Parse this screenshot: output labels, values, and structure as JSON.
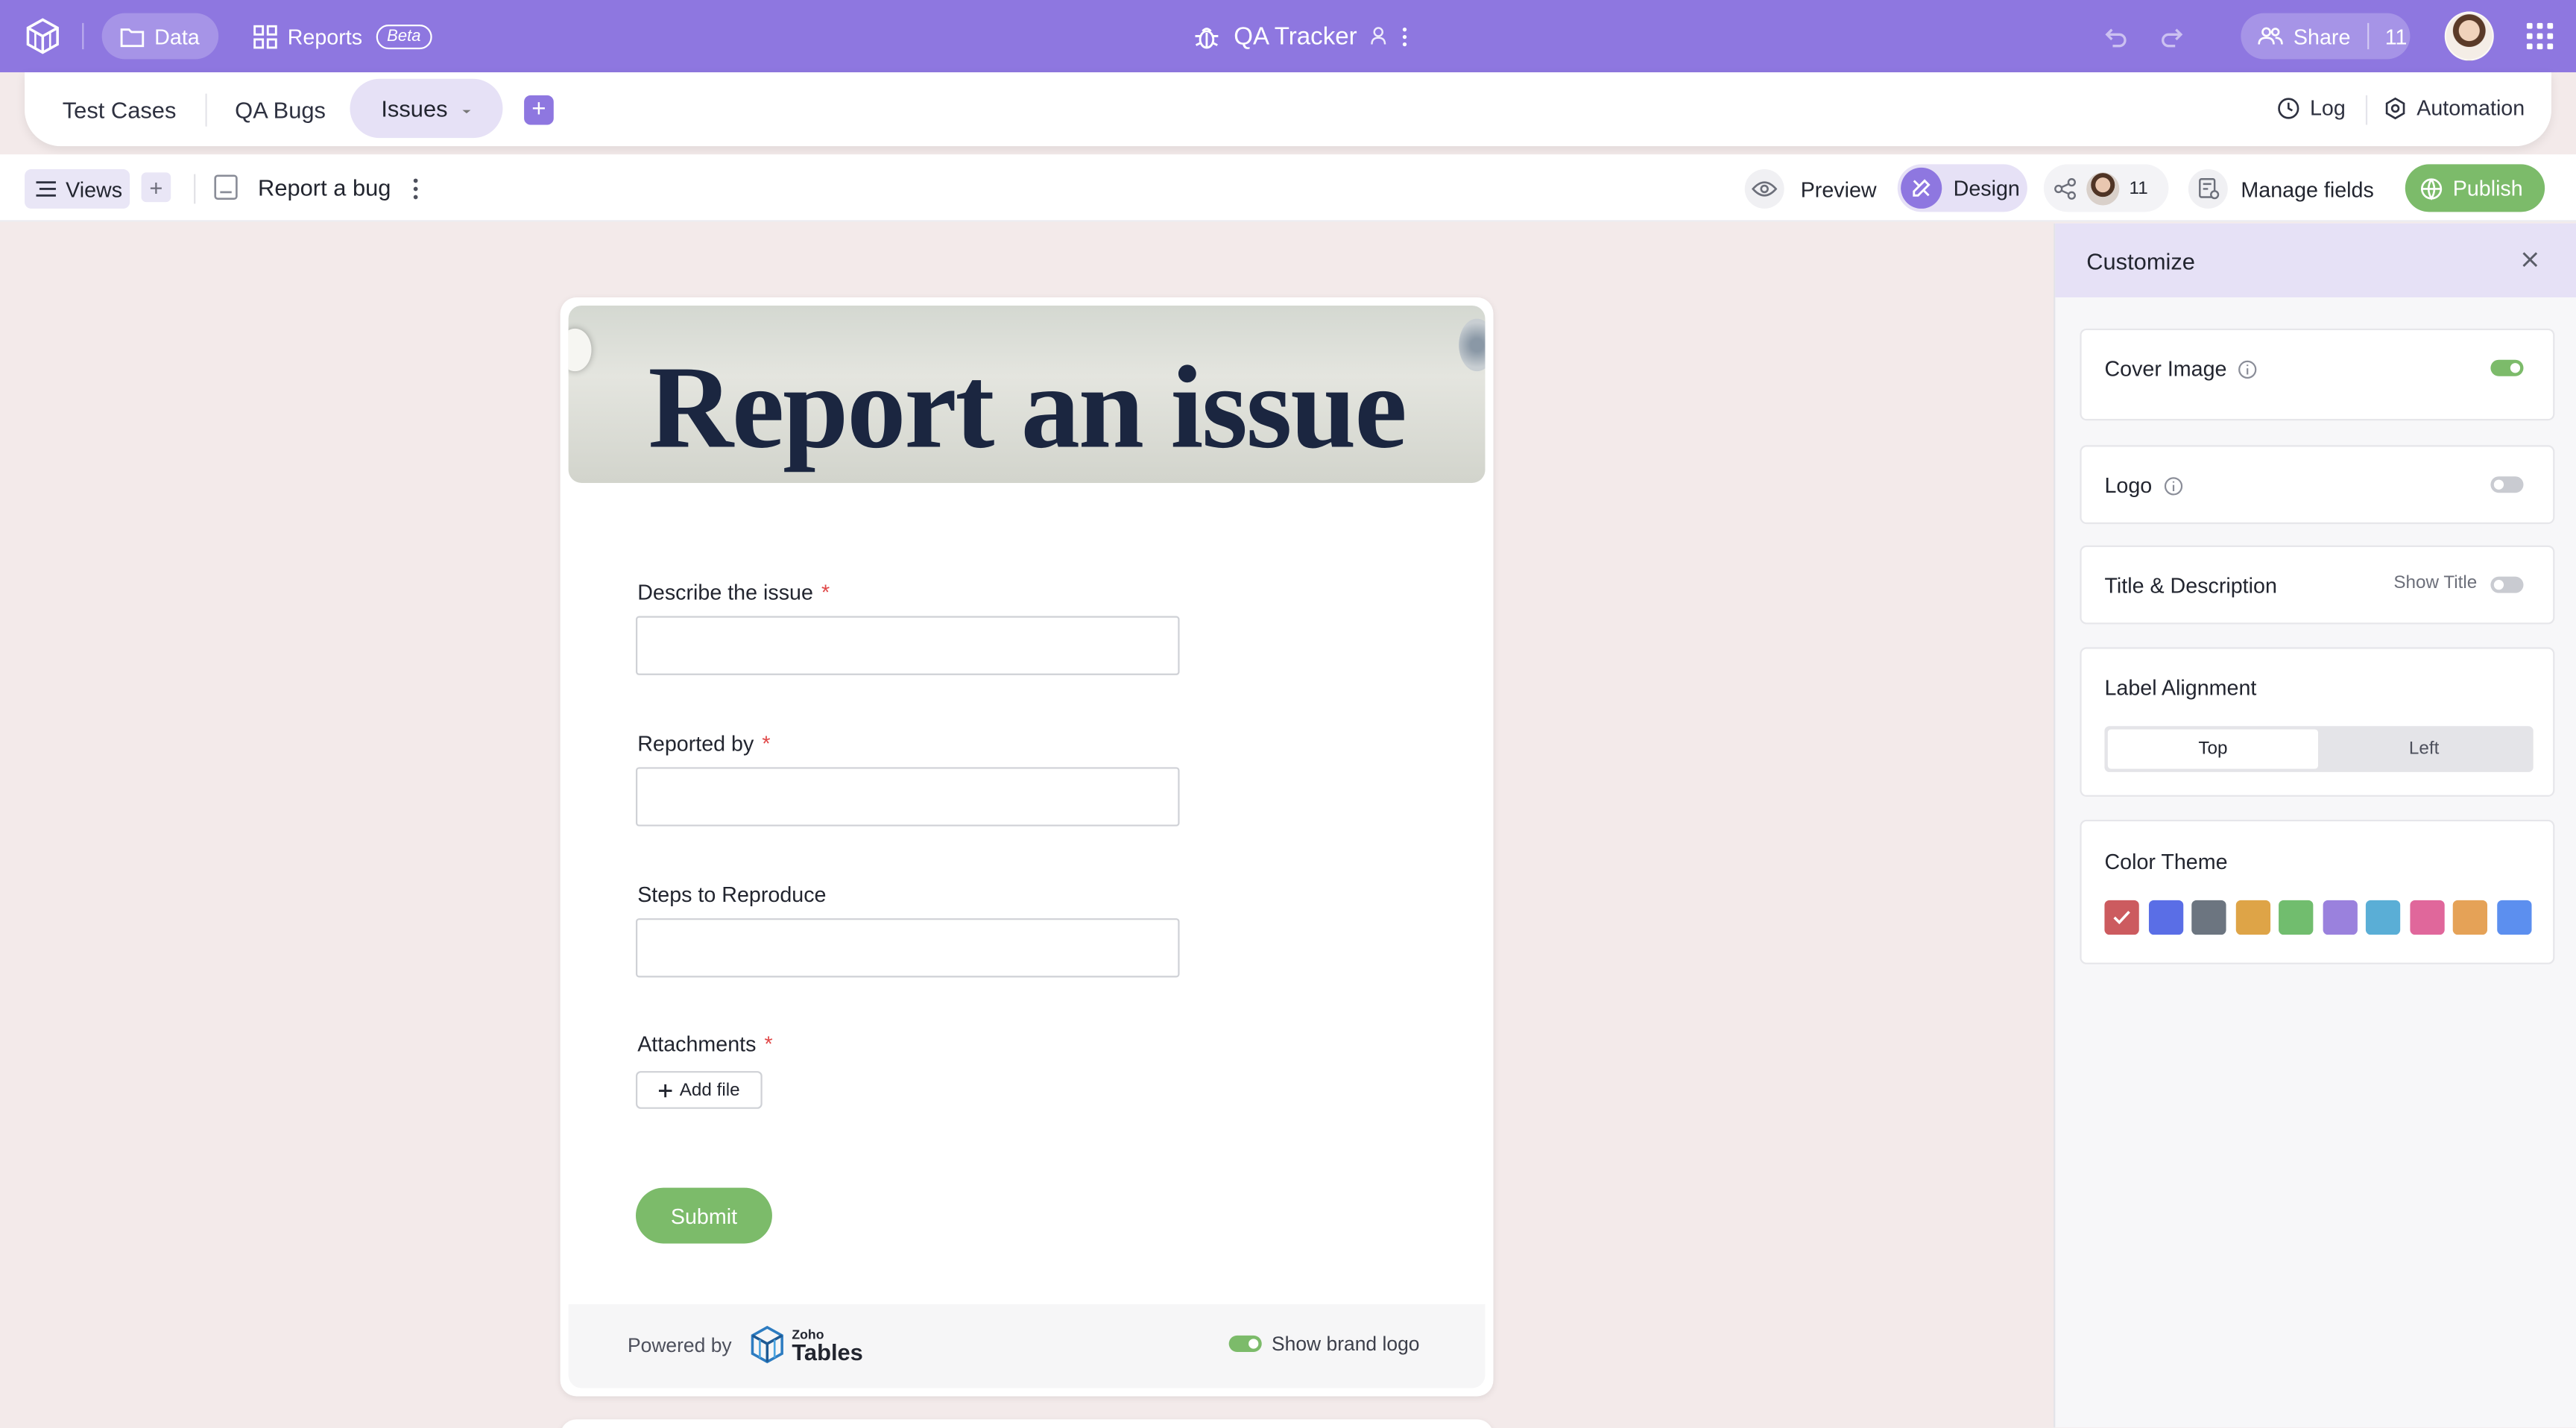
{
  "topbar": {
    "data_label": "Data",
    "reports_label": "Reports",
    "beta_label": "Beta",
    "app_title": "QA Tracker",
    "share_label": "Share",
    "share_count": "11"
  },
  "tabs": [
    {
      "label": "Test Cases"
    },
    {
      "label": "QA Bugs"
    },
    {
      "label": "Issues"
    }
  ],
  "tabbar": {
    "log_label": "Log",
    "automation_label": "Automation"
  },
  "viewsbar": {
    "views_label": "Views",
    "view_name": "Report a bug",
    "preview_label": "Preview",
    "design_label": "Design",
    "collab_count": "11",
    "manage_fields_label": "Manage fields",
    "publish_label": "Publish"
  },
  "form": {
    "cover_text": "Report an issue",
    "fields": [
      {
        "label": "Describe the issue",
        "required": "*"
      },
      {
        "label": "Reported by",
        "required": "*"
      },
      {
        "label": "Steps to Reproduce",
        "required": ""
      },
      {
        "label": "Attachments",
        "required": "*"
      }
    ],
    "add_file_label": "Add file",
    "submit_label": "Submit",
    "powered_by": "Powered by",
    "zoho_small": "Zoho",
    "zoho_big": "Tables",
    "show_brand_logo": "Show brand logo",
    "show_brand_logo_on": true
  },
  "customize": {
    "title": "Customize",
    "cover_image_label": "Cover Image",
    "cover_image_on": true,
    "logo_label": "Logo",
    "logo_on": false,
    "title_desc_label": "Title & Description",
    "show_title_label": "Show Title",
    "show_title_on": false,
    "label_alignment_label": "Label Alignment",
    "alignment_options": [
      "Top",
      "Left"
    ],
    "alignment_selected": "Top",
    "color_theme_label": "Color Theme",
    "colors": [
      "#cc5b5f",
      "#5a6ee6",
      "#6c7580",
      "#dea447",
      "#71bd6e",
      "#9a81dd",
      "#5aaed6",
      "#e0679b",
      "#e5a257",
      "#5c8fef"
    ],
    "selected_color": "#cc5b5f"
  },
  "colors": {
    "brand_purple": "#8e77e0",
    "accent_green": "#7cbb6a",
    "required_red": "#e04848"
  }
}
